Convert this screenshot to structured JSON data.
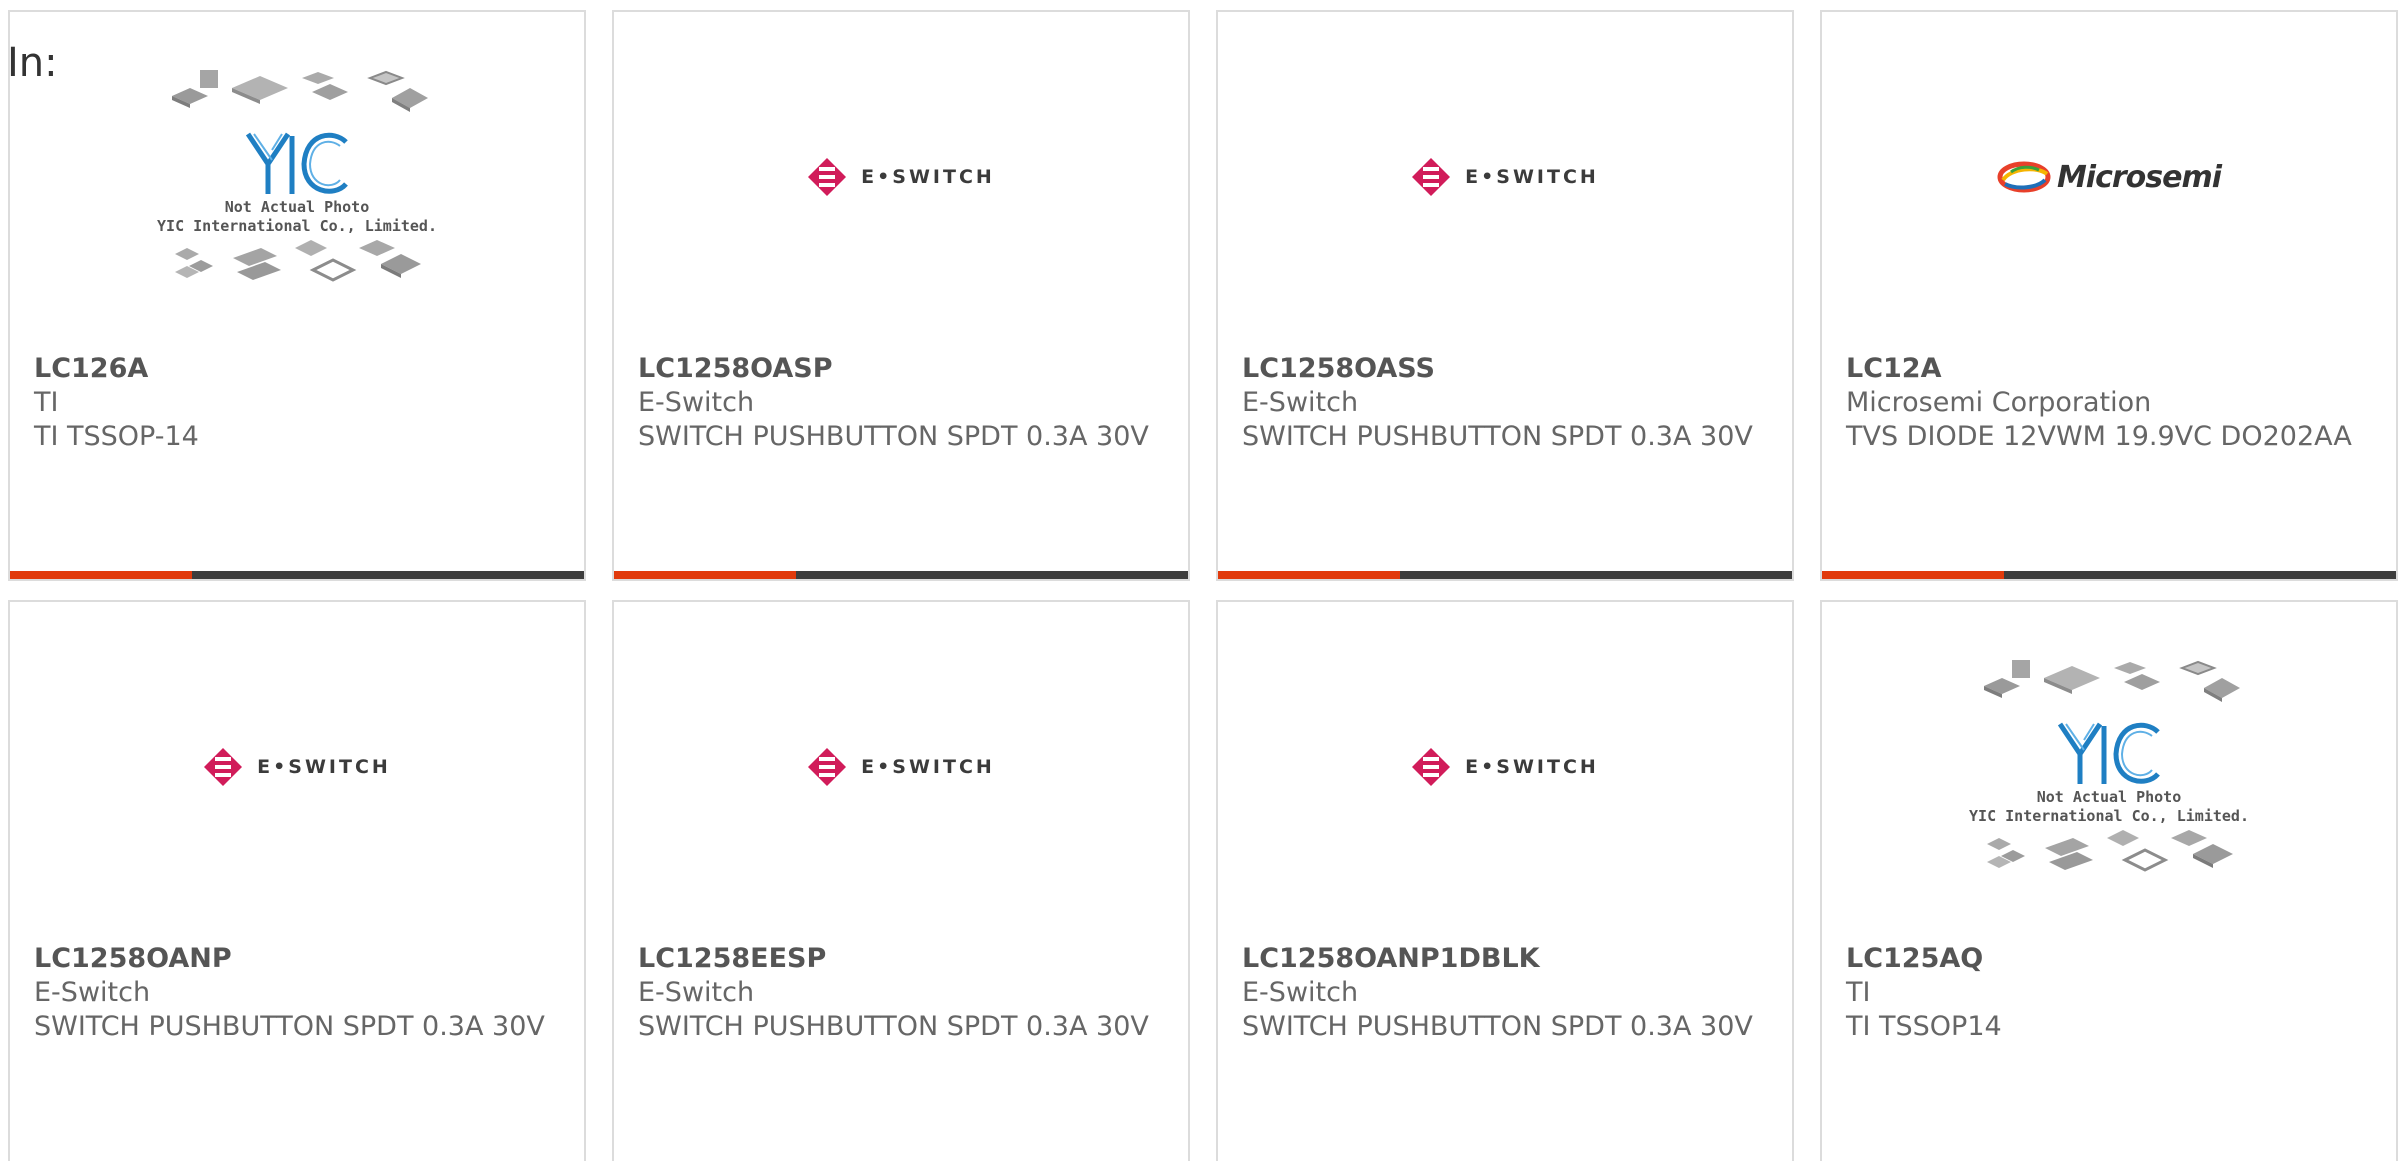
{
  "filter_label": "In:",
  "colors": {
    "accent_bar": "#e13a0c",
    "dark_bar": "#3d3d3d",
    "eswitch_red": "#d11c5a",
    "yic_blue": "#1f7fc3"
  },
  "placeholder": {
    "line1": "Not Actual Photo",
    "line2": "YIC International Co., Limited."
  },
  "logos": {
    "eswitch": "E•SWITCH",
    "microsemi": "Microsemi"
  },
  "products": [
    {
      "part": "LC126A",
      "manufacturer": "TI",
      "description": "TI TSSOP-14",
      "image": "yic-placeholder"
    },
    {
      "part": "LC1258OASP",
      "manufacturer": "E-Switch",
      "description": "SWITCH PUSHBUTTON SPDT 0.3A 30V",
      "image": "eswitch-logo"
    },
    {
      "part": "LC1258OASS",
      "manufacturer": "E-Switch",
      "description": "SWITCH PUSHBUTTON SPDT 0.3A 30V",
      "image": "eswitch-logo"
    },
    {
      "part": "LC12A",
      "manufacturer": "Microsemi Corporation",
      "description": "TVS DIODE 12VWM 19.9VC DO202AA",
      "image": "microsemi-logo"
    },
    {
      "part": "LC1258OANP",
      "manufacturer": "E-Switch",
      "description": "SWITCH PUSHBUTTON SPDT 0.3A 30V",
      "image": "eswitch-logo"
    },
    {
      "part": "LC1258EESP",
      "manufacturer": "E-Switch",
      "description": "SWITCH PUSHBUTTON SPDT 0.3A 30V",
      "image": "eswitch-logo"
    },
    {
      "part": "LC1258OANP1DBLK",
      "manufacturer": "E-Switch",
      "description": "SWITCH PUSHBUTTON SPDT 0.3A 30V",
      "image": "eswitch-logo"
    },
    {
      "part": "LC125AQ",
      "manufacturer": "TI",
      "description": "TI TSSOP14",
      "image": "yic-placeholder"
    }
  ]
}
